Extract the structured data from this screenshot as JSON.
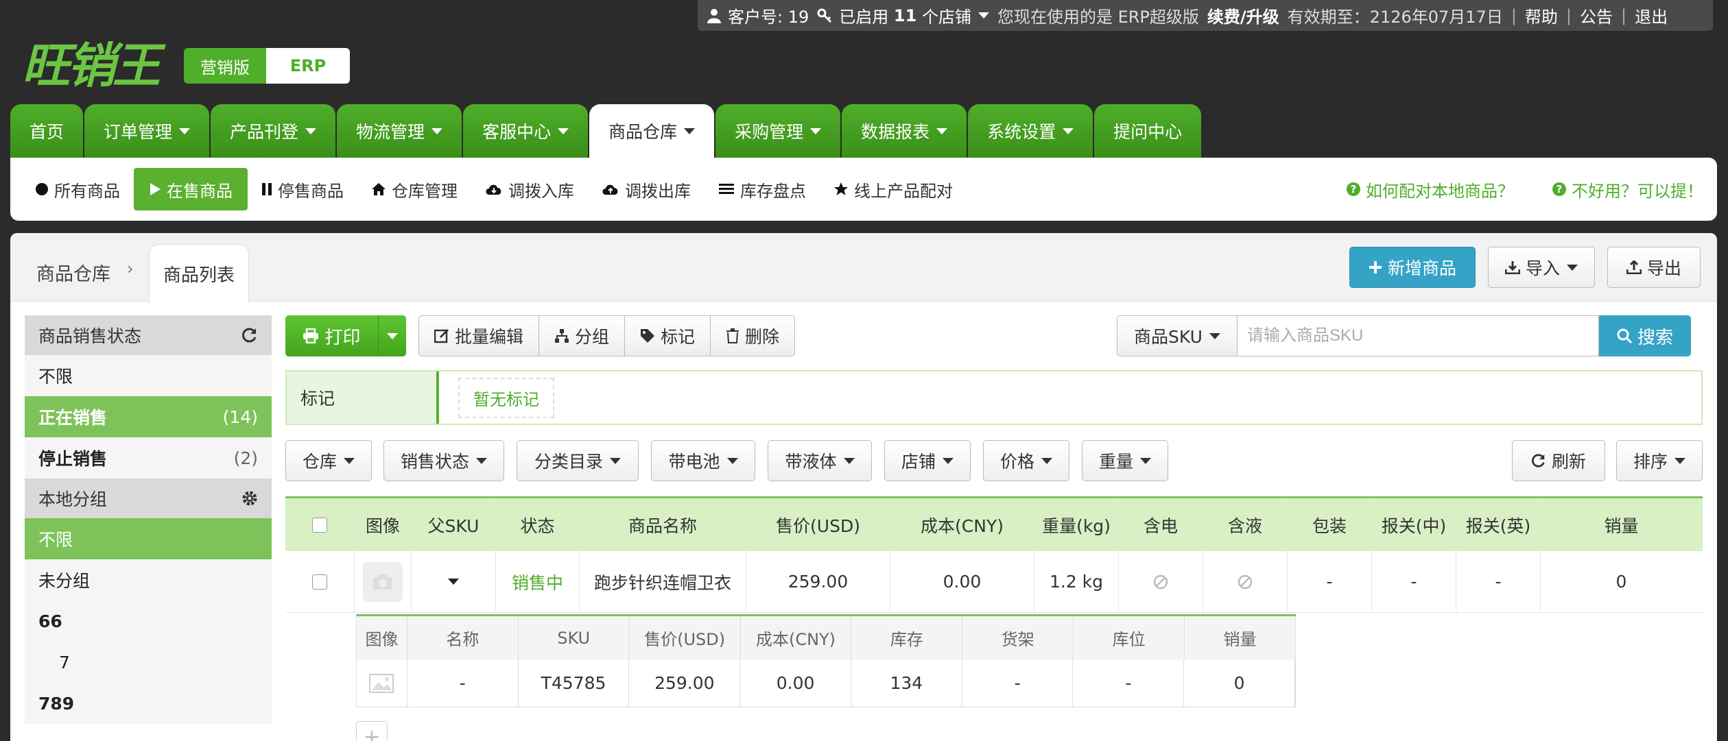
{
  "topbar": {
    "customer": "客户号: 19",
    "enabled_prefix": "已启用",
    "enabled_count": "11",
    "enabled_suffix": "个店铺",
    "using": "您现在使用的是 ERP超级版",
    "renew": "续费/升级",
    "expire": "有效期至：2126年07月17日",
    "help": "帮助",
    "notice": "公告",
    "logout": "退出"
  },
  "brand": {
    "logo": "旺销王",
    "version_a": "营销版",
    "version_b": "ERP"
  },
  "main_nav": [
    {
      "label": "首页",
      "caret": false
    },
    {
      "label": "订单管理",
      "caret": true
    },
    {
      "label": "产品刊登",
      "caret": true
    },
    {
      "label": "物流管理",
      "caret": true
    },
    {
      "label": "客服中心",
      "caret": true
    },
    {
      "label": "商品仓库",
      "caret": true,
      "active": true
    },
    {
      "label": "采购管理",
      "caret": true
    },
    {
      "label": "数据报表",
      "caret": true
    },
    {
      "label": "系统设置",
      "caret": true
    },
    {
      "label": "提问中心",
      "caret": false
    }
  ],
  "sub_nav": [
    {
      "label": "所有商品",
      "icon": "circle-icon"
    },
    {
      "label": "在售商品",
      "icon": "play-icon",
      "active": true
    },
    {
      "label": "停售商品",
      "icon": "pause-icon"
    },
    {
      "label": "仓库管理",
      "icon": "home-icon"
    },
    {
      "label": "调拨入库",
      "icon": "cloud-download-icon"
    },
    {
      "label": "调拨出库",
      "icon": "cloud-upload-icon"
    },
    {
      "label": "库存盘点",
      "icon": "list-icon"
    },
    {
      "label": "线上产品配对",
      "icon": "star-icon"
    }
  ],
  "help_links": [
    "如何配对本地商品？",
    "不好用？可以提！"
  ],
  "breadcrumb": {
    "parent": "商品仓库",
    "current": "商品列表"
  },
  "header_buttons": {
    "add": "新增商品",
    "import": "导入",
    "export": "导出"
  },
  "sidebar": {
    "status_title": "商品销售状态",
    "status_items": [
      {
        "label": "不限",
        "count": ""
      },
      {
        "label": "正在销售",
        "count": "(14)"
      },
      {
        "label": "停止销售",
        "count": "(2)"
      }
    ],
    "group_title": "本地分组",
    "group_items": [
      "不限",
      "未分组",
      "66",
      "7",
      "789"
    ]
  },
  "toolbar": {
    "print": "打印",
    "batch_edit": "批量编辑",
    "group": "分组",
    "mark": "标记",
    "delete": "删除",
    "search_field": "商品SKU",
    "search_placeholder": "请输入商品SKU",
    "search_btn": "搜索"
  },
  "marks": {
    "label": "标记",
    "empty": "暂无标记"
  },
  "filters": [
    "仓库",
    "销售状态",
    "分类目录",
    "带电池",
    "带液体",
    "店铺",
    "价格",
    "重量"
  ],
  "filter_right": {
    "refresh": "刷新",
    "sort": "排序"
  },
  "table": {
    "headers": [
      "图像",
      "父SKU",
      "状态",
      "商品名称",
      "售价(USD)",
      "成本(CNY)",
      "重量(kg)",
      "含电",
      "含液",
      "包装",
      "报关(中)",
      "报关(英)",
      "销量"
    ],
    "rows": [
      {
        "status": "销售中",
        "name": "跑步针织连帽卫衣",
        "price": "259.00",
        "cost": "0.00",
        "weight": "1.2 kg",
        "pack": "-",
        "decl_cn": "-",
        "decl_en": "-",
        "sales": "0"
      }
    ]
  },
  "variants": {
    "headers": [
      "图像",
      "名称",
      "SKU",
      "售价(USD)",
      "成本(CNY)",
      "库存",
      "货架",
      "库位",
      "销量"
    ],
    "rows": [
      {
        "name": "-",
        "sku": "T45785",
        "price": "259.00",
        "cost": "0.00",
        "stock": "134",
        "shelf": "-",
        "bin": "-",
        "sales": "0"
      }
    ]
  }
}
